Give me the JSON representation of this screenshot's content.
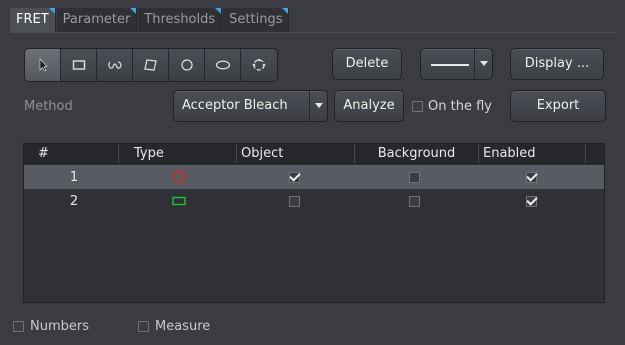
{
  "tabs": [
    {
      "label": "FRET",
      "active": true
    },
    {
      "label": "Parameter",
      "active": false
    },
    {
      "label": "Thresholds",
      "active": false
    },
    {
      "label": "Settings",
      "active": false
    }
  ],
  "toolbar": {
    "tools": [
      "pointer-icon",
      "rectangle-icon",
      "freehand-icon",
      "polygon-icon",
      "circle-icon",
      "ellipse-icon",
      "spline-icon"
    ],
    "delete_label": "Delete",
    "display_label": "Display ..."
  },
  "method": {
    "label": "Method",
    "selected": "Acceptor Bleach",
    "analyze_label": "Analyze",
    "on_the_fly_label": "On the fly",
    "on_the_fly_checked": false,
    "export_label": "Export"
  },
  "table": {
    "columns": [
      "#",
      "Type",
      "Object",
      "Background",
      "Enabled"
    ],
    "rows": [
      {
        "num": "1",
        "type": "circle-shape-icon",
        "color": "#e02a2a",
        "object": true,
        "background": false,
        "enabled": true,
        "selected": true
      },
      {
        "num": "2",
        "type": "rectangle-shape-icon",
        "color": "#22c03a",
        "object": false,
        "background": false,
        "enabled": true,
        "selected": false
      }
    ]
  },
  "footer": {
    "numbers_label": "Numbers",
    "numbers_checked": false,
    "measure_label": "Measure",
    "measure_checked": false
  },
  "colors": {
    "accent": "#3fa4e8",
    "background": "#3a3c41"
  }
}
